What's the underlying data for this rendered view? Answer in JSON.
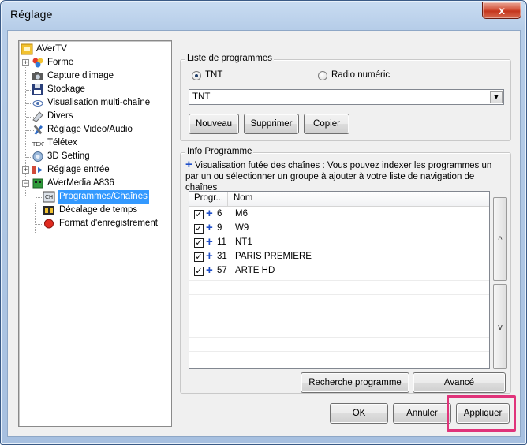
{
  "window": {
    "title": "Réglage",
    "close_label": "x"
  },
  "tree": {
    "items": [
      {
        "label": "AVerTV",
        "icon": "avertv-icon"
      },
      {
        "label": "Forme",
        "icon": "forme-icon"
      },
      {
        "label": "Capture d'image",
        "icon": "camera-icon"
      },
      {
        "label": "Stockage",
        "icon": "disk-icon"
      },
      {
        "label": "Visualisation multi-chaîne",
        "icon": "eye-icon"
      },
      {
        "label": "Divers",
        "icon": "divers-icon"
      },
      {
        "label": "Réglage Vidéo/Audio",
        "icon": "tools-icon"
      },
      {
        "label": "Télétex",
        "icon": "teletext-icon"
      },
      {
        "label": "3D Setting",
        "icon": "3d-icon"
      },
      {
        "label": "Réglage entrée",
        "icon": "input-icon"
      },
      {
        "label": "AVerMedia A836",
        "icon": "device-icon"
      },
      {
        "label": "Programmes/Chaînes",
        "icon": "channel-icon"
      },
      {
        "label": "Décalage de temps",
        "icon": "timeshift-icon"
      },
      {
        "label": "Format d'enregistrement",
        "icon": "record-icon"
      }
    ]
  },
  "liste_programmes": {
    "title": "Liste de programmes",
    "radio_tnt": "TNT",
    "radio_radio": "Radio numéric",
    "combo_value": "TNT",
    "btn_nouveau": "Nouveau",
    "btn_supprimer": "Supprimer",
    "btn_copier": "Copier"
  },
  "info_programme": {
    "title": "Info Programme",
    "description": "Visualisation futée des chaînes : Vous pouvez indexer les programmes un par un ou sélectionner un groupe à ajouter à votre liste de navigation de chaînes",
    "columns": [
      "Progr...",
      "Nom"
    ],
    "rows": [
      {
        "num": "6",
        "name": "M6"
      },
      {
        "num": "9",
        "name": "W9"
      },
      {
        "num": "11",
        "name": "NT1"
      },
      {
        "num": "31",
        "name": "PARIS PREMIERE"
      },
      {
        "num": "57",
        "name": "ARTE HD"
      }
    ],
    "scroll_up": "^",
    "scroll_down": "v",
    "btn_recherche": "Recherche programme",
    "btn_avance": "Avancé"
  },
  "footer": {
    "ok": "OK",
    "annuler": "Annuler",
    "appliquer": "Appliquer"
  },
  "colors": {
    "selection": "#3399ff",
    "highlight": "#e0337a",
    "plus": "#1f4fc9"
  }
}
